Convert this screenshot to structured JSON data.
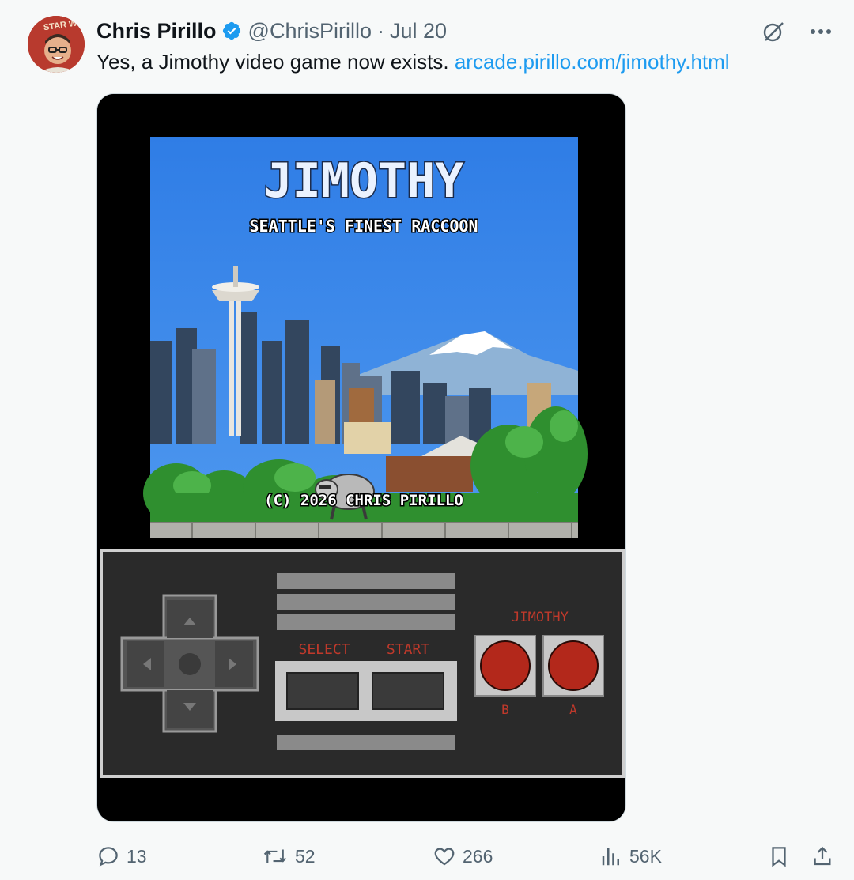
{
  "author": {
    "name": "Chris Pirillo",
    "handle": "@ChrisPirillo",
    "separator": "·",
    "date": "Jul 20",
    "avatar_badge": "STAR WARS"
  },
  "tweet": {
    "text": "Yes, a Jimothy video game now exists. ",
    "link": "arcade.pirillo.com/jimothy.html"
  },
  "game": {
    "title": "JIMOTHY",
    "subtitle": "SEATTLE'S FINEST RACCOON",
    "copyright": "(C) 2026 CHRIS PIRILLO",
    "controller_brand": "JIMOTHY",
    "select_label": "SELECT",
    "start_label": "START",
    "b_label": "B",
    "a_label": "A"
  },
  "metrics": {
    "replies": "13",
    "retweets": "52",
    "likes": "266",
    "views": "56K"
  },
  "icons": {
    "verified": "verified-badge-icon",
    "grok": "grok-icon",
    "more": "more-icon",
    "reply": "reply-icon",
    "retweet": "retweet-icon",
    "like": "heart-icon",
    "views": "views-icon",
    "bookmark": "bookmark-icon",
    "share": "share-icon"
  },
  "colors": {
    "link": "#1d9bf0",
    "muted": "#536471",
    "verified": "#1d9bf0",
    "controller_red": "#c0392b"
  }
}
